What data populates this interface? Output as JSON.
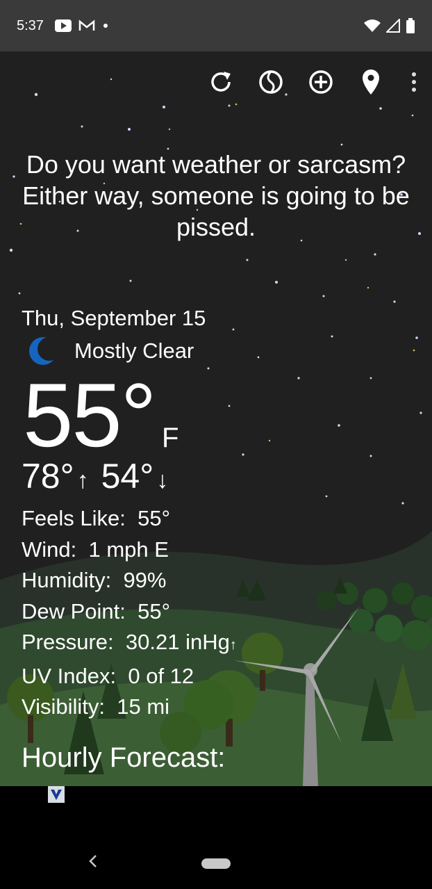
{
  "status_bar": {
    "time": "5:37"
  },
  "toolbar": {
    "icons": [
      "refresh-icon",
      "radar-icon",
      "add-location-icon",
      "location-pin-icon",
      "more-vert-icon"
    ]
  },
  "quote": "Do you want weather or sarcasm? Either way, someone is going to be pissed.",
  "weather": {
    "date": "Thu, September 15",
    "condition": "Mostly Clear",
    "temperature": "55°",
    "unit": "F",
    "high": "78°",
    "low": "54°",
    "details": [
      {
        "label": "Feels Like:",
        "value": "55°"
      },
      {
        "label": "Wind:",
        "value": "1 mph E"
      },
      {
        "label": "Humidity:",
        "value": "99%"
      },
      {
        "label": "Dew Point:",
        "value": "55°"
      },
      {
        "label": "Pressure:",
        "value": "30.21 inHg"
      },
      {
        "label": "UV Index:",
        "value": "0 of 12"
      },
      {
        "label": "Visibility:",
        "value": "15 mi"
      }
    ],
    "hourly_title": "Hourly Forecast:"
  },
  "colors": {
    "moon": "#1565c0",
    "sky": "#202020",
    "hills": "#2f4a2e",
    "status_bar": "#3a3a3a"
  }
}
